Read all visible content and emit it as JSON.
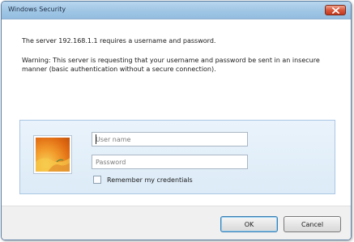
{
  "window": {
    "title": "Windows Security"
  },
  "messages": {
    "server_prompt": "The server 192.168.1.1 requires a username and password.",
    "warning": "Warning: This server is requesting that your username and password be sent in an insecure manner (basic authentication without a secure connection)."
  },
  "credentials": {
    "username_placeholder": "User name",
    "username_value": "",
    "password_placeholder": "Password",
    "password_value": "",
    "remember_label": "Remember my credentials",
    "remember_checked": false
  },
  "buttons": {
    "ok": "OK",
    "cancel": "Cancel"
  },
  "icons": {
    "close": "close-icon",
    "avatar": "user-avatar-icon"
  },
  "colors": {
    "titlebar": "#a3c8e6",
    "close_button": "#d8563a",
    "panel": "#dcebf7",
    "avatar_orange": "#f29b2c"
  }
}
